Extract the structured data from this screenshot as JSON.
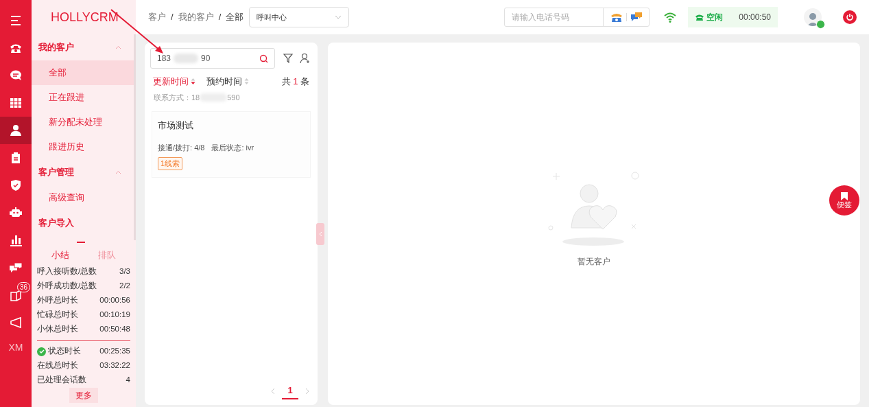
{
  "rail": {
    "items": [
      {
        "kind": "menu",
        "selected": false
      },
      {
        "kind": "phone",
        "selected": false
      },
      {
        "kind": "chat",
        "selected": false
      },
      {
        "kind": "grid",
        "selected": false
      },
      {
        "kind": "person",
        "selected": true
      },
      {
        "kind": "clipboard",
        "selected": false
      },
      {
        "kind": "shield",
        "selected": false
      },
      {
        "kind": "robot",
        "selected": false
      },
      {
        "kind": "chart",
        "selected": false
      },
      {
        "kind": "bubbles",
        "selected": false
      },
      {
        "kind": "book",
        "selected": false,
        "badge": "36"
      },
      {
        "kind": "megaphone",
        "selected": false
      }
    ],
    "user_initials": "XM"
  },
  "logo": "HOLLYCRM",
  "sidebar": {
    "groups": [
      {
        "label": "我的客户",
        "expanded": true,
        "children": [
          {
            "label": "全部",
            "selected": true
          },
          {
            "label": "正在跟进",
            "selected": false
          },
          {
            "label": "新分配未处理",
            "selected": false
          },
          {
            "label": "跟进历史",
            "selected": false
          }
        ]
      },
      {
        "label": "客户管理",
        "expanded": true,
        "children": [
          {
            "label": "高级查询",
            "selected": false
          }
        ]
      },
      {
        "label": "客户导入",
        "expanded": false
      }
    ]
  },
  "summary": {
    "tabs": [
      {
        "label": "小结",
        "selected": true
      },
      {
        "label": "排队",
        "selected": false
      }
    ],
    "stats": [
      {
        "label": "呼入接听数/总数",
        "value": "3/3"
      },
      {
        "label": "外呼成功数/总数",
        "value": "2/2"
      },
      {
        "label": "外呼总时长",
        "value": "00:00:56"
      },
      {
        "label": "忙碌总时长",
        "value": "00:10:19"
      },
      {
        "label": "小休总时长",
        "value": "00:50:48"
      }
    ],
    "status_stats": [
      {
        "label": "状态时长",
        "value": "00:25:35",
        "ok": true
      },
      {
        "label": "在线总时长",
        "value": "03:32:22"
      },
      {
        "label": "已处理会话数",
        "value": "4"
      }
    ],
    "more": "更多"
  },
  "breadcrumb": {
    "separator": "/",
    "items": [
      "客户",
      "我的客户",
      "全部"
    ]
  },
  "channel_select": {
    "value": "呼叫中心"
  },
  "topbar": {
    "phone_field": {
      "placeholder": "请输入电话号码"
    },
    "status": "空闲",
    "timer": "00:00:50",
    "online": true
  },
  "customer_list": {
    "search": {
      "value_start": "183",
      "value_end": "90"
    },
    "sorts": [
      {
        "label": "更新时间",
        "selected": true
      },
      {
        "label": "预约时间",
        "selected": false
      }
    ],
    "count_prefix": "共",
    "count": "1",
    "count_suffix": "条",
    "contact_label": "联系方式：18",
    "contact_end": "590",
    "cards": [
      {
        "name": "市场测试",
        "calls_label": "接通/拨打:",
        "calls": "4/8",
        "status_label": "最后状态:",
        "status": "ivr",
        "tag": "1线索"
      }
    ],
    "pages": [
      {
        "label": "1",
        "selected": true
      }
    ]
  },
  "detail": {
    "empty_text": "暂无客户"
  },
  "note_button": "便签"
}
